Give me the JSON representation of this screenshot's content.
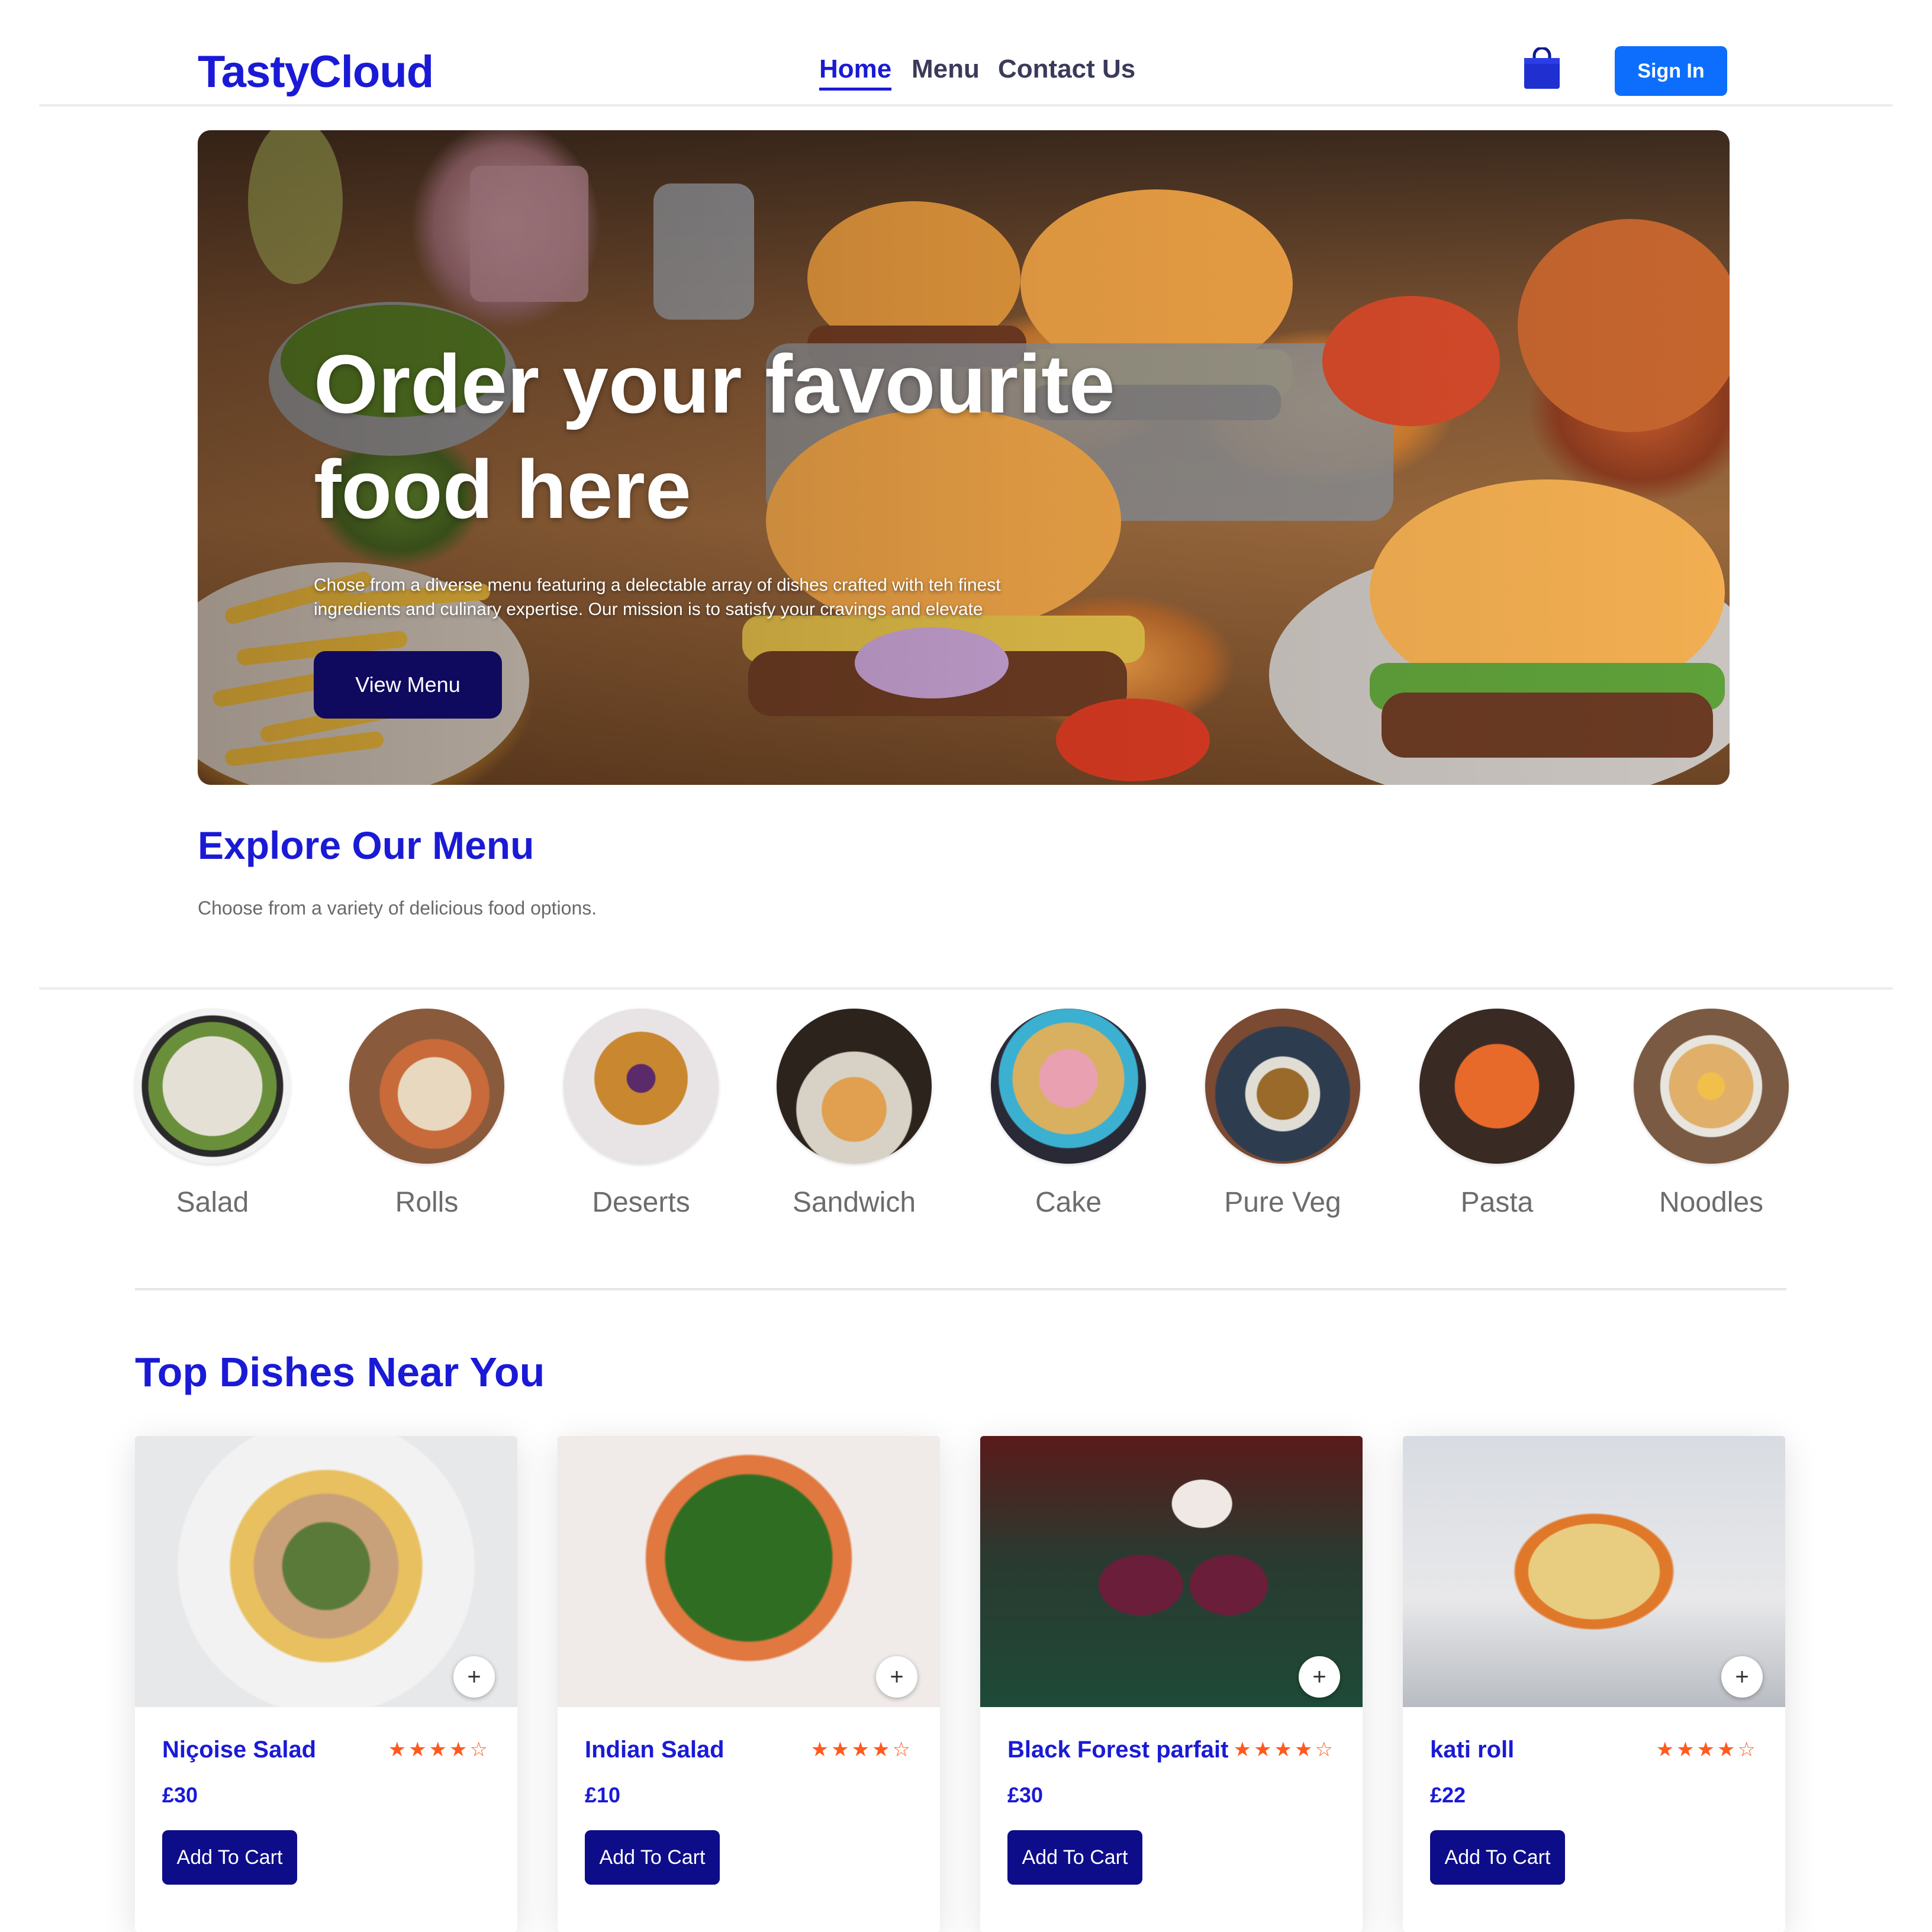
{
  "header": {
    "logo": "TastyCloud",
    "nav": [
      {
        "label": "Home",
        "active": true
      },
      {
        "label": "Menu",
        "active": false
      },
      {
        "label": "Contact Us",
        "active": false
      }
    ],
    "cart_icon": "shopping-bag-icon",
    "signin_label": "Sign In",
    "accent_color": "#1a1ad6",
    "signin_color": "#0d6efd"
  },
  "hero": {
    "title": "Order your favourite food here",
    "description": "Chose from a diverse menu featuring a delectable array of dishes crafted with teh finest ingredients and culinary expertise. Our mission is to satisfy your cravings and elevate",
    "button_label": "View Menu",
    "button_color": "#0f0a5e"
  },
  "explore": {
    "title": "Explore Our Menu",
    "subtitle": "Choose from a variety of delicious food options."
  },
  "categories": [
    {
      "label": "Salad"
    },
    {
      "label": "Rolls"
    },
    {
      "label": "Deserts"
    },
    {
      "label": "Sandwich"
    },
    {
      "label": "Cake"
    },
    {
      "label": "Pure Veg"
    },
    {
      "label": "Pasta"
    },
    {
      "label": "Noodles"
    }
  ],
  "top_dishes": {
    "title": "Top Dishes Near You",
    "items": [
      {
        "name": "Niçoise Salad",
        "price": "£30",
        "rating": 4,
        "rating_max": 5,
        "stars": "★★★★☆",
        "add_label": "Add To Cart",
        "add_icon": "+"
      },
      {
        "name": "Indian Salad",
        "price": "£10",
        "rating": 4,
        "rating_max": 5,
        "stars": "★★★★☆",
        "add_label": "Add To Cart",
        "add_icon": "+"
      },
      {
        "name": "Black Forest parfait",
        "price": "£30",
        "rating": 4,
        "rating_max": 5,
        "stars": "★★★★☆",
        "add_label": "Add To Cart",
        "add_icon": "+"
      },
      {
        "name": "kati roll",
        "price": "£22",
        "rating": 4,
        "rating_max": 5,
        "stars": "★★★★☆",
        "add_label": "Add To Cart",
        "add_icon": "+"
      }
    ],
    "star_color": "#ff5a1f",
    "button_color": "#0d0d8a"
  }
}
